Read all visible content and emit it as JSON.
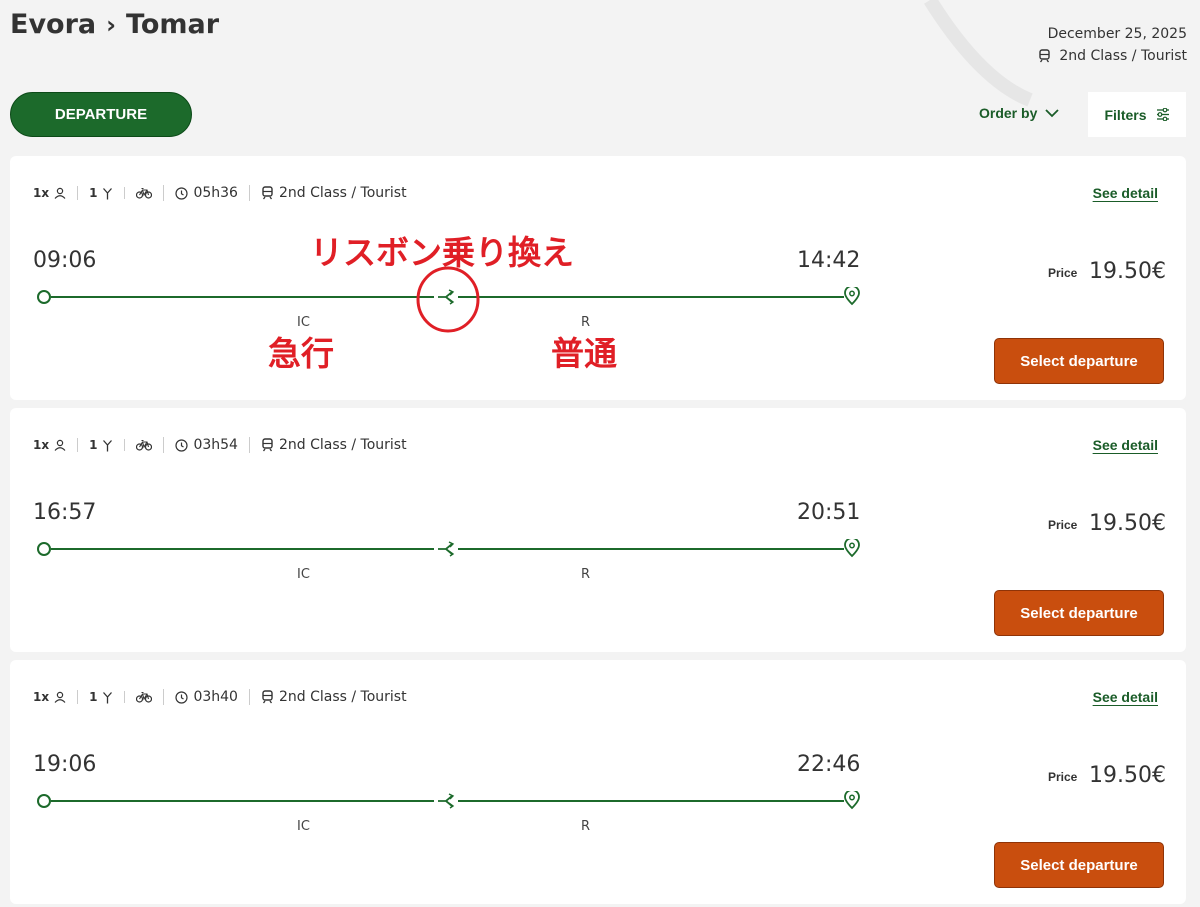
{
  "header": {
    "title_from": "Evora",
    "title_sep": "›",
    "title_to": "Tomar",
    "date": "December 25, 2025",
    "class": "2nd Class / Tourist",
    "departure_label": "DEPARTURE",
    "order_by_label": "Order by",
    "filters_label": "Filters"
  },
  "trips": [
    {
      "passengers": "1x",
      "transfers": "1",
      "duration": "05h36",
      "class": "2nd Class / Tourist",
      "see_detail": "See detail",
      "departure": "09:06",
      "arrival": "14:42",
      "seg1": "IC",
      "seg2": "R",
      "price_label": "Price",
      "price": "19.50€",
      "select_label": "Select departure"
    },
    {
      "passengers": "1x",
      "transfers": "1",
      "duration": "03h54",
      "class": "2nd Class / Tourist",
      "see_detail": "See detail",
      "departure": "16:57",
      "arrival": "20:51",
      "seg1": "IC",
      "seg2": "R",
      "price_label": "Price",
      "price": "19.50€",
      "select_label": "Select departure"
    },
    {
      "passengers": "1x",
      "transfers": "1",
      "duration": "03h40",
      "class": "2nd Class / Tourist",
      "see_detail": "See detail",
      "departure": "19:06",
      "arrival": "22:46",
      "seg1": "IC",
      "seg2": "R",
      "price_label": "Price",
      "price": "19.50€",
      "select_label": "Select departure"
    }
  ],
  "annotations": {
    "transfer": "リスボン乗り換え",
    "express": "急行",
    "local": "普通"
  },
  "colors": {
    "primary_green": "#1c6a2b",
    "accent_orange": "#c94e0e",
    "annotation_red": "#e01f26"
  }
}
